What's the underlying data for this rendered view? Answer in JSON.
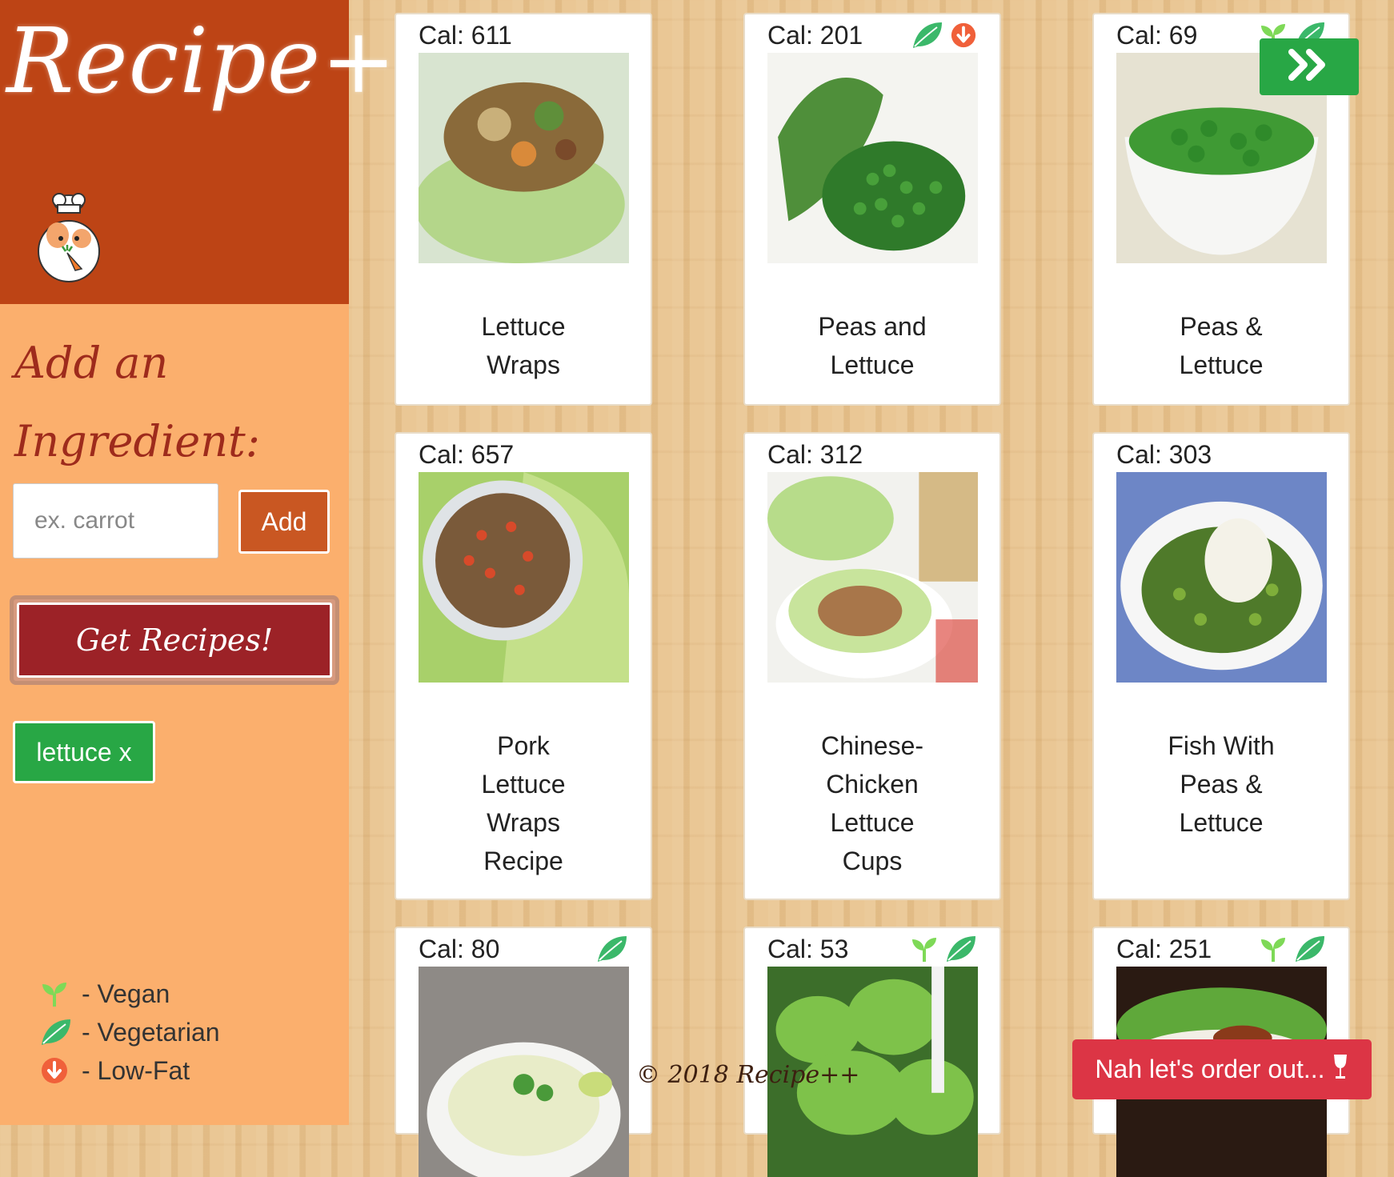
{
  "brand": {
    "logo_text": "Recipe++"
  },
  "sidebar": {
    "heading": "Add an Ingredient:",
    "input_placeholder": "ex. carrot",
    "add_label": "Add",
    "get_recipes_label": "Get Recipes!",
    "chips": [
      {
        "label": "lettuce x"
      }
    ],
    "legend": [
      {
        "icon": "sprout-icon",
        "label": "- Vegan"
      },
      {
        "icon": "leaf-icon",
        "label": "- Vegetarian"
      },
      {
        "icon": "low-fat-icon",
        "label": "- Low-Fat"
      }
    ]
  },
  "recipes": [
    {
      "cal": "Cal: 611",
      "title": "Lettuce Wraps",
      "badges": []
    },
    {
      "cal": "Cal: 201",
      "title": "Peas and Lettuce",
      "badges": [
        "leaf-icon",
        "low-fat-icon"
      ]
    },
    {
      "cal": "Cal: 69",
      "title": "Peas & Lettuce",
      "badges": [
        "sprout-icon",
        "leaf-icon"
      ]
    },
    {
      "cal": "Cal: 657",
      "title": "Pork Lettuce Wraps Recipe",
      "badges": []
    },
    {
      "cal": "Cal: 312",
      "title": "Chinese-Chicken Lettuce Cups",
      "badges": []
    },
    {
      "cal": "Cal: 303",
      "title": "Fish With Peas & Lettuce",
      "badges": []
    },
    {
      "cal": "Cal: 80",
      "title": "",
      "badges": [
        "leaf-icon"
      ]
    },
    {
      "cal": "Cal: 53",
      "title": "",
      "badges": [
        "sprout-icon",
        "leaf-icon"
      ]
    },
    {
      "cal": "Cal: 251",
      "title": "",
      "badges": [
        "sprout-icon",
        "leaf-icon"
      ]
    }
  ],
  "footer": {
    "copyright": "© 2018 Recipe++",
    "order_out_label": "Nah let's order out..."
  },
  "colors": {
    "brand_bg": "#bd4415",
    "sidebar_bg": "#fbaf6d",
    "add_button": "#c95722",
    "get_recipes_button": "#9c2227",
    "chip_green": "#28a745",
    "order_out_red": "#dc3545",
    "vegan_green": "#7ed957",
    "vegetarian_green": "#3bb86a",
    "low_fat_orange": "#f0603a"
  }
}
